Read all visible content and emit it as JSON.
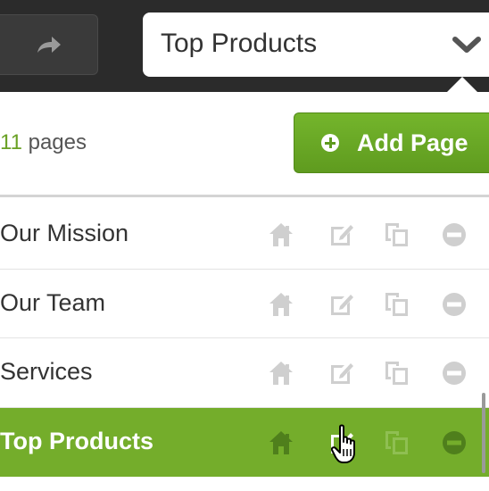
{
  "toolbar": {
    "forward_icon": "arrow-forward-icon",
    "page_select": {
      "value": "Top Products",
      "icon": "chevron-down-icon"
    }
  },
  "panel": {
    "count_number": "11",
    "count_suffix": " pages",
    "add_button_label": "Add Page",
    "add_button_icon": "plus-circle-icon"
  },
  "pages": [
    {
      "label": "Our Mission",
      "active": false
    },
    {
      "label": "Our Team",
      "active": false
    },
    {
      "label": "Services",
      "active": false
    },
    {
      "label": "Top Products",
      "active": true
    }
  ],
  "row_actions": [
    "home-icon",
    "edit-icon",
    "duplicate-icon",
    "delete-icon"
  ],
  "colors": {
    "accent_green": "#74ad2b",
    "count_green": "#6aa125",
    "toolbar_dark": "#2b2b2b",
    "icon_gray": "#cfcfcf"
  }
}
